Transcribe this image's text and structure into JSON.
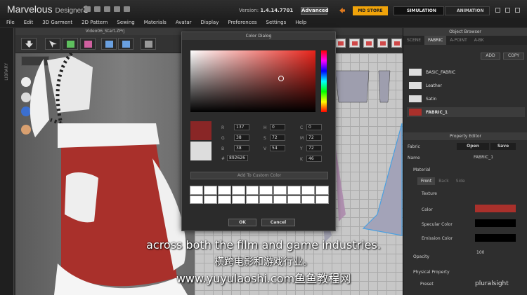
{
  "titlebar": {
    "app_name": "Marvelous",
    "app_sub": "Designer",
    "app_ver": "3",
    "version_label": "Version:",
    "version": "1.4.14.7701",
    "mode": "Advanced",
    "md_store": "MD STORE",
    "simulation": "SIMULATION",
    "animation": "ANIMATION"
  },
  "menu": [
    "File",
    "Edit",
    "3D Garment",
    "2D Pattern",
    "Sewing",
    "Materials",
    "Avatar",
    "Display",
    "Preferences",
    "Settings",
    "Help"
  ],
  "view3d": {
    "title": "Video06_Start.ZPrj",
    "library": "LIBRARY"
  },
  "color_dialog": {
    "title": "Color Dialog",
    "r": "137",
    "g": "38",
    "b": "38",
    "h": "0",
    "s": "72",
    "v": "54",
    "c": "0",
    "m": "72",
    "y": "72",
    "k": "46",
    "hex": "892626",
    "add_custom": "Add To Custom Color",
    "ok": "OK",
    "cancel": "Cancel",
    "labels": {
      "r": "R",
      "g": "G",
      "b": "B",
      "h": "H",
      "s": "S",
      "v": "V",
      "c": "C",
      "m": "M",
      "y": "Y",
      "k": "K",
      "hash": "#",
      "pct": "%"
    }
  },
  "object_browser": {
    "title": "Object Browser",
    "tabs": [
      "SCENE",
      "FABRIC",
      "A-POINT",
      "A-BK"
    ],
    "add": "ADD",
    "copy": "COPY",
    "fabrics": [
      "BASIC_FABRIC",
      "Leather",
      "Satin",
      "FABRIC_1"
    ]
  },
  "property_editor": {
    "title": "Property Editor",
    "fabric_label": "Fabric",
    "open": "Open",
    "save": "Save",
    "name_label": "Name",
    "name_value": "FABRIC_1",
    "material": "Material",
    "front": "Front",
    "back": "Back",
    "side": "Side",
    "texture": "Texture",
    "color": "Color",
    "specular": "Specular Color",
    "emission": "Emission Color",
    "opacity": "Opacity",
    "opacity_value": "100",
    "physical": "Physical Property",
    "preset": "Preset"
  },
  "colors": {
    "fabric": "#a9302b",
    "current": "#892626"
  },
  "subtitles": {
    "en": "across both the film and game industries.",
    "zh": "横跨电影和游戏行业。",
    "url": "www.yuyulaoshi.com鱼鱼教程网"
  },
  "watermark": "pluralsight"
}
